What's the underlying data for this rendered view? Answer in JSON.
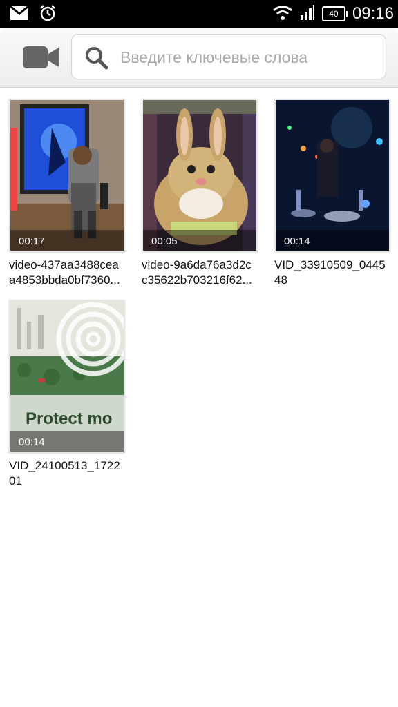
{
  "status_bar": {
    "time": "09:16",
    "battery": "40",
    "icons": [
      "mail-icon",
      "alarm-icon",
      "wifi-icon",
      "signal-icon",
      "battery-icon"
    ]
  },
  "toolbar": {
    "icon": "video-camera-icon",
    "search_placeholder": "Введите ключевые слова"
  },
  "videos": [
    {
      "duration": "00:17",
      "caption_line1": "video-437aa3488cea",
      "caption_line2": "a4853bbda0bf7360..."
    },
    {
      "duration": "00:05",
      "caption_line1": "video-9a6da76a3d2c",
      "caption_line2": "c35622b703216f62..."
    },
    {
      "duration": "00:14",
      "caption_line1": "VID_33910509_0445",
      "caption_line2": "48"
    },
    {
      "duration": "00:14",
      "caption_line1": "VID_24100513_1722",
      "caption_line2": "01",
      "overlay_text": "Protect mo"
    }
  ]
}
